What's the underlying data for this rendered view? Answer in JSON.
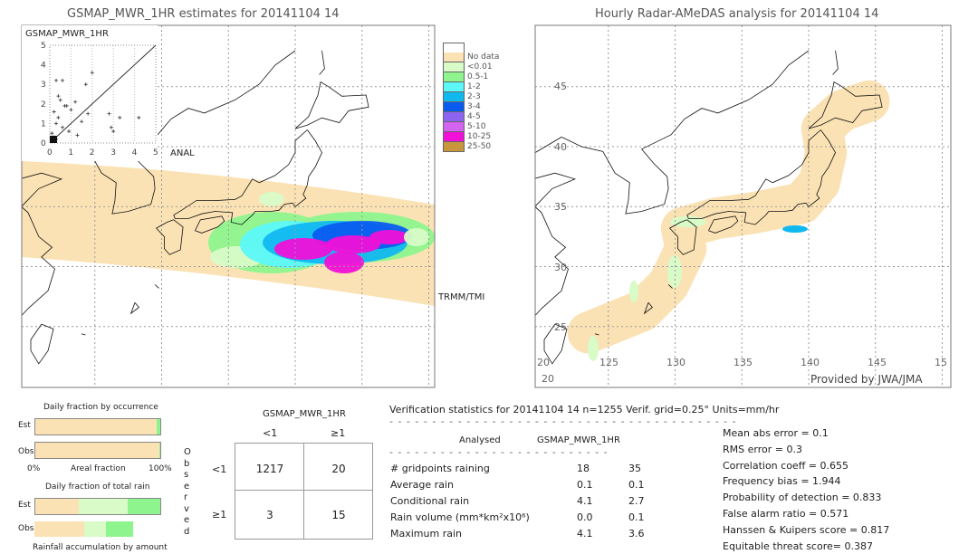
{
  "left_map": {
    "title": "GSMAP_MWR_1HR estimates for 20141104 14",
    "inset_label": "GSMAP_MWR_1HR",
    "x_axis_label": "ANAL",
    "swath_label": "TRMM/TMI"
  },
  "right_map": {
    "title": "Hourly Radar-AMeDAS analysis for 20141104 14",
    "credit": "Provided by JWA/JMA",
    "lat_ticks": [
      "45",
      "40",
      "35",
      "30",
      "25",
      "20"
    ],
    "lon_ticks": [
      "125",
      "130",
      "135",
      "140",
      "145",
      "15"
    ]
  },
  "legend": [
    {
      "label": "No data",
      "color": "#fbe2b4"
    },
    {
      "label": "<0.01",
      "color": "#d8fbc8"
    },
    {
      "label": "0.5-1",
      "color": "#8ef58e"
    },
    {
      "label": "1-2",
      "color": "#5cf8f8"
    },
    {
      "label": "2-3",
      "color": "#10b8f0"
    },
    {
      "label": "3-4",
      "color": "#0a5cf0"
    },
    {
      "label": "4-5",
      "color": "#8c64f0"
    },
    {
      "label": "5-10",
      "color": "#d264f0"
    },
    {
      "label": "10-25",
      "color": "#f010d8"
    },
    {
      "label": "25-50",
      "color": "#c8963c"
    }
  ],
  "chart_data": {
    "type": "scatter",
    "xlabel": "ANAL",
    "ylabel": "GSMAP_MWR_1HR",
    "xlim": [
      0,
      5
    ],
    "ylim": [
      0,
      5
    ],
    "x_ticks": [
      "0",
      "1",
      "2",
      "3",
      "4",
      "5"
    ],
    "y_ticks": [
      "0",
      "1",
      "2",
      "3",
      "4",
      "5"
    ],
    "points": [
      [
        0.3,
        3.2
      ],
      [
        0.6,
        3.2
      ],
      [
        0.4,
        2.4
      ],
      [
        0.5,
        2.2
      ],
      [
        0.7,
        1.9
      ],
      [
        0.8,
        1.9
      ],
      [
        1.2,
        2.1
      ],
      [
        1.0,
        1.7
      ],
      [
        0.2,
        1.6
      ],
      [
        0.4,
        1.3
      ],
      [
        0.3,
        1.0
      ],
      [
        0.6,
        0.8
      ],
      [
        0.9,
        0.6
      ],
      [
        1.3,
        0.4
      ],
      [
        1.5,
        1.1
      ],
      [
        1.8,
        1.5
      ],
      [
        2.8,
        1.5
      ],
      [
        2.9,
        0.8
      ],
      [
        3.0,
        0.6
      ],
      [
        3.3,
        1.3
      ],
      [
        4.2,
        1.3
      ],
      [
        2.0,
        3.6
      ],
      [
        1.7,
        3.0
      ],
      [
        0.1,
        0.1
      ],
      [
        0.2,
        0.3
      ],
      [
        0.1,
        0.5
      ],
      [
        0.3,
        0.2
      ]
    ]
  },
  "occurrence": {
    "title": "Daily fraction by occurrence",
    "est_label": "Est",
    "obs_label": "Obs",
    "axis_left": "0%",
    "axis_mid": "Areal fraction",
    "axis_right": "100%",
    "est_fractions": [
      0.97,
      0.03
    ],
    "obs_fractions": [
      0.99,
      0.01
    ]
  },
  "total_rain": {
    "title": "Daily fraction of total rain",
    "est_label": "Est",
    "obs_label": "Obs",
    "caption": "Rainfall accumulation by amount",
    "est_fractions": [
      0.35,
      0.39,
      0.26
    ],
    "obs_fractions": [
      0.4,
      0.17,
      0.22
    ]
  },
  "contingency": {
    "title": "GSMAP_MWR_1HR",
    "col_headers": [
      "<1",
      "≥1"
    ],
    "row_headers": [
      "<1",
      "≥1"
    ],
    "row_axis_label": "Observed",
    "cells": [
      [
        "1217",
        "20"
      ],
      [
        "3",
        "15"
      ]
    ]
  },
  "stats": {
    "header": "Verification statistics for 20141104 14   n=1255   Verif. grid=0.25°   Units=mm/hr",
    "col_analysed": "Analysed",
    "col_est": "GSMAP_MWR_1HR",
    "rows": [
      {
        "label": "# gridpoints raining",
        "a": "18",
        "b": "35"
      },
      {
        "label": "Average rain",
        "a": "0.1",
        "b": "0.1"
      },
      {
        "label": "Conditional rain",
        "a": "4.1",
        "b": "2.7"
      },
      {
        "label": "Rain volume (mm*km²x10⁶)",
        "a": "0.0",
        "b": "0.1"
      },
      {
        "label": "Maximum rain",
        "a": "4.1",
        "b": "3.6"
      }
    ],
    "scores": [
      "Mean abs error = 0.1",
      "RMS error = 0.3",
      "Correlation coeff = 0.655",
      "Frequency bias = 1.944",
      "Probability of detection = 0.833",
      "False alarm ratio = 0.571",
      "Hanssen & Kuipers score = 0.817",
      "Equitable threat score= 0.387"
    ]
  }
}
